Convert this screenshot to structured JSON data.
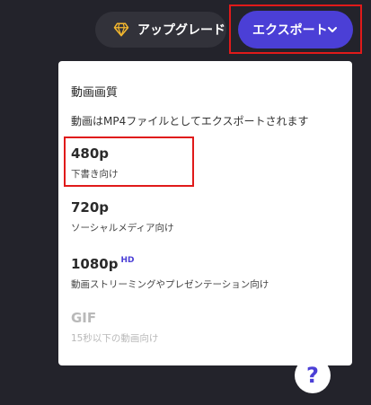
{
  "header": {
    "upgrade_label": "アップグレード",
    "export_label": "エクスポート"
  },
  "panel": {
    "title": "動画画質",
    "description": "動画はMP4ファイルとしてエクスポートされます",
    "options": [
      {
        "title": "480p",
        "subtitle": "下書き向け",
        "enabled": true
      },
      {
        "title": "720p",
        "subtitle": "ソーシャルメディア向け",
        "enabled": true
      },
      {
        "title": "1080p",
        "badge": "HD",
        "subtitle": "動画ストリーミングやプレゼンテーション向け",
        "enabled": true
      },
      {
        "title": "GIF",
        "subtitle": "15秒以下の動画向け",
        "enabled": false
      }
    ]
  },
  "help": {
    "label": "?"
  },
  "icons": {
    "upgrade": "diamond-icon",
    "export": "chevron-down-icon"
  },
  "colors": {
    "background": "#23232b",
    "accent": "#4b3fd6",
    "gem": "#f5b82e",
    "highlight": "#e01a1a",
    "disabled_text": "#b9b9b9"
  }
}
